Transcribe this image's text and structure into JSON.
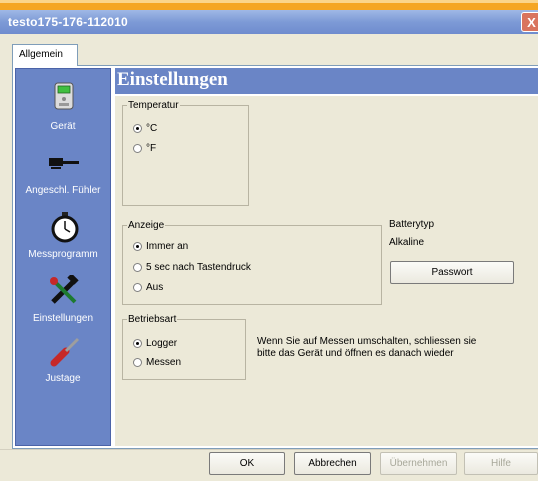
{
  "window": {
    "title": "testo175-176-112010",
    "close_symbol": "X"
  },
  "tabs": [
    {
      "label": "Allgemein",
      "selected": true
    }
  ],
  "sidebar": {
    "items": [
      {
        "label": "Gerät",
        "icon": "device-icon"
      },
      {
        "label": "Angeschl. Fühler",
        "icon": "probe-icon"
      },
      {
        "label": "Messprogramm",
        "icon": "stopwatch-icon"
      },
      {
        "label": "Einstellungen",
        "icon": "tools-icon"
      },
      {
        "label": "Justage",
        "icon": "screwdriver-icon"
      }
    ]
  },
  "page": {
    "heading": "Einstellungen"
  },
  "temperatur": {
    "legend": "Temperatur",
    "options": [
      {
        "label": "°C",
        "selected": true
      },
      {
        "label": "°F",
        "selected": false
      }
    ]
  },
  "anzeige": {
    "legend": "Anzeige",
    "options": [
      {
        "label": "Immer an",
        "selected": true
      },
      {
        "label": "5 sec nach Tastendruck",
        "selected": false
      },
      {
        "label": "Aus",
        "selected": false
      }
    ]
  },
  "battery": {
    "label": "Batterytyp",
    "value": "Alkaline"
  },
  "password_button": "Passwort",
  "betriebsart": {
    "legend": "Betriebsart",
    "options": [
      {
        "label": "Logger",
        "selected": true
      },
      {
        "label": "Messen",
        "selected": false
      }
    ]
  },
  "hint": {
    "line1": "Wenn Sie auf Messen umschalten, schliessen sie",
    "line2": "bitte das Gerät und öffnen es danach wieder"
  },
  "footer": {
    "ok": "OK",
    "cancel": "Abbrechen",
    "apply": "Übernehmen",
    "help": "Hilfe"
  },
  "colors": {
    "title_bar": "#7d9ad6",
    "sidebar": "#6a85c6",
    "dialog_face": "#ece9d8",
    "orange_band": "#f5a623"
  }
}
